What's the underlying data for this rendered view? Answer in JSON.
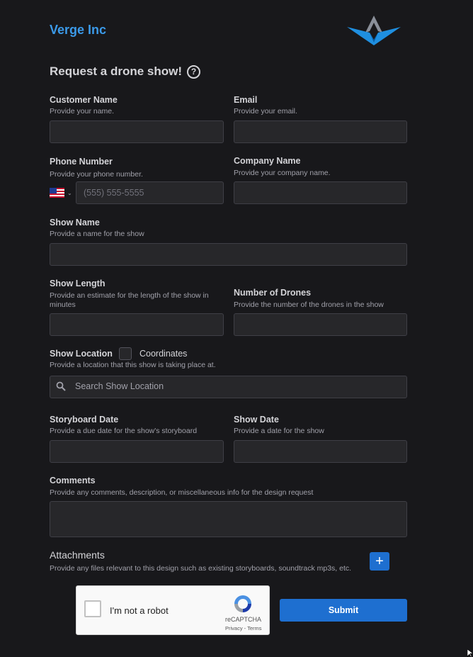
{
  "header": {
    "brand": "Verge Inc",
    "title": "Request a drone show!",
    "help_icon": "?"
  },
  "fields": {
    "customer_name": {
      "label": "Customer Name",
      "help": "Provide your name.",
      "value": ""
    },
    "email": {
      "label": "Email",
      "help": "Provide your email.",
      "value": ""
    },
    "phone": {
      "label": "Phone Number",
      "help": "Provide your phone number.",
      "placeholder": "(555) 555-5555",
      "country": "US",
      "value": ""
    },
    "company": {
      "label": "Company Name",
      "help": "Provide your company name.",
      "value": ""
    },
    "show_name": {
      "label": "Show Name",
      "help": "Provide a name for the show",
      "value": ""
    },
    "show_length": {
      "label": "Show Length",
      "help": "Provide an estimate for the length of the show in minutes",
      "value": ""
    },
    "num_drones": {
      "label": "Number of Drones",
      "help": "Provide the number of the drones in the show",
      "value": ""
    },
    "show_location": {
      "label": "Show Location",
      "coordinates_label": "Coordinates",
      "coordinates_checked": false,
      "help": "Provide a location that this show is taking place at.",
      "placeholder": "Search Show Location"
    },
    "storyboard_date": {
      "label": "Storyboard Date",
      "help": "Provide a due date for the show's storyboard",
      "value": ""
    },
    "show_date": {
      "label": "Show Date",
      "help": "Provide a date for the show",
      "value": ""
    },
    "comments": {
      "label": "Comments",
      "help": "Provide any comments, description, or miscellaneous info for the design request",
      "value": ""
    },
    "attachments": {
      "label": "Attachments",
      "help": "Provide any files relevant to this design such as existing storyboards, soundtrack mp3s, etc.",
      "add_icon": "+"
    }
  },
  "captcha": {
    "label": "I'm not a robot",
    "brand": "reCAPTCHA",
    "links": "Privacy - Terms"
  },
  "actions": {
    "submit": "Submit"
  },
  "colors": {
    "background": "#18181b",
    "accent": "#1e6fd0",
    "brand": "#3b9ae9",
    "input": "#27272a"
  }
}
